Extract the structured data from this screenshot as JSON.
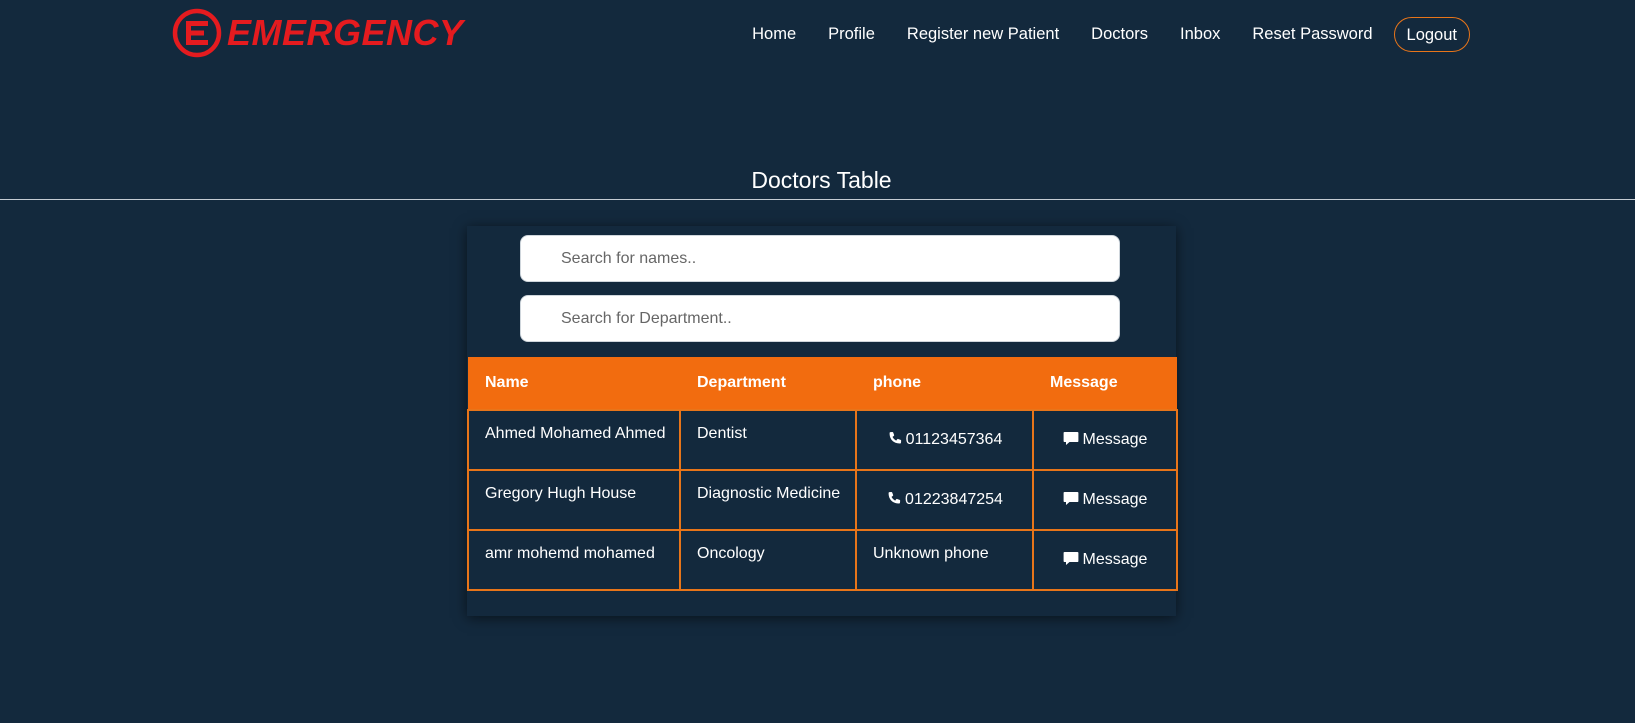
{
  "brand": {
    "name": "EMERGENCY",
    "color": "#e51b1f"
  },
  "nav": {
    "items": [
      {
        "label": "Home"
      },
      {
        "label": "Profile"
      },
      {
        "label": "Register new Patient"
      },
      {
        "label": "Doctors"
      },
      {
        "label": "Inbox"
      },
      {
        "label": "Reset Password"
      }
    ],
    "logout_label": "Logout"
  },
  "page": {
    "title": "Doctors Table"
  },
  "search": {
    "names_placeholder": "Search for names..",
    "department_placeholder": "Search for Department..",
    "icon": "search-icon"
  },
  "table": {
    "headers": [
      "Name",
      "Department",
      "phone",
      "Message"
    ],
    "rows": [
      {
        "name": "Ahmed Mohamed Ahmed",
        "department": "Dentist",
        "phone": "01123457364",
        "message": "Message"
      },
      {
        "name": "Gregory Hugh House",
        "department": "Diagnostic Medicine",
        "phone": "01223847254",
        "message": "Message"
      },
      {
        "name": "amr mohemd mohamed",
        "department": "Oncology",
        "phone": "Unknown phone",
        "message": "Message"
      }
    ]
  },
  "colors": {
    "background": "#13293d",
    "accent": "#f26c0f",
    "border": "#e8751a"
  },
  "icons": {
    "phone": "phone-icon",
    "message": "comment-icon"
  }
}
